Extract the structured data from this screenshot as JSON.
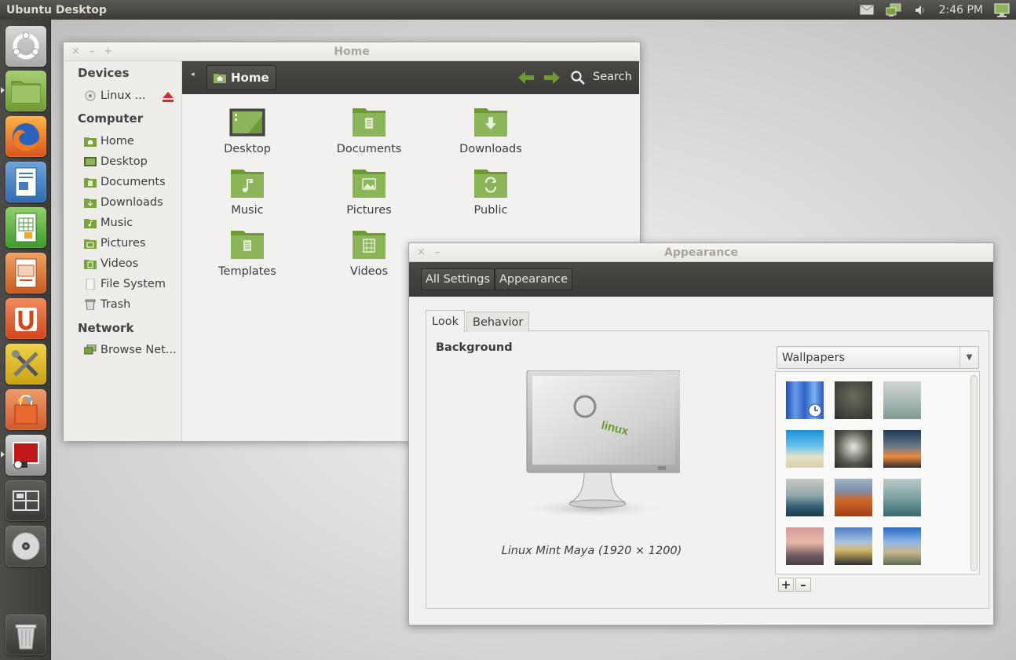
{
  "top_panel": {
    "title": "Ubuntu Desktop",
    "clock": "2:46 PM",
    "tray_icons": [
      "mail-icon",
      "network-icon",
      "volume-icon",
      "session-icon"
    ]
  },
  "launcher": {
    "items": [
      "ubuntu-dash",
      "files",
      "firefox",
      "writer",
      "calc",
      "impress",
      "software-center",
      "system-settings",
      "shopping",
      "image-viewer",
      "workspace-switcher",
      "optical-drive",
      "trash"
    ]
  },
  "file_manager": {
    "window_title": "Home",
    "window_buttons": [
      "×",
      "–",
      "+"
    ],
    "location": "Home",
    "search_label": "Search",
    "sidebar": {
      "devices_header": "Devices",
      "devices": [
        "Linux ..."
      ],
      "computer_header": "Computer",
      "computer": [
        "Home",
        "Desktop",
        "Documents",
        "Downloads",
        "Music",
        "Pictures",
        "Videos",
        "File System",
        "Trash"
      ],
      "network_header": "Network",
      "network": [
        "Browse Net..."
      ]
    },
    "folders": [
      "Desktop",
      "Documents",
      "Downloads",
      "Music",
      "Pictures",
      "Public",
      "Templates",
      "Videos"
    ]
  },
  "appearance": {
    "window_title": "Appearance",
    "window_buttons": [
      "×",
      "–"
    ],
    "breadcrumb": [
      "All Settings",
      "Appearance"
    ],
    "tabs": [
      "Look",
      "Behavior"
    ],
    "background_label": "Background",
    "wallpaper_caption": "Linux Mint Maya (1920 × 1200)",
    "source_selected": "Wallpapers",
    "add_label": "+",
    "remove_label": "–",
    "colors": {
      "accent_green": "#7aa33d",
      "folder_green": "#8cb458",
      "toolbar_dark": "#3f3e3b"
    }
  }
}
